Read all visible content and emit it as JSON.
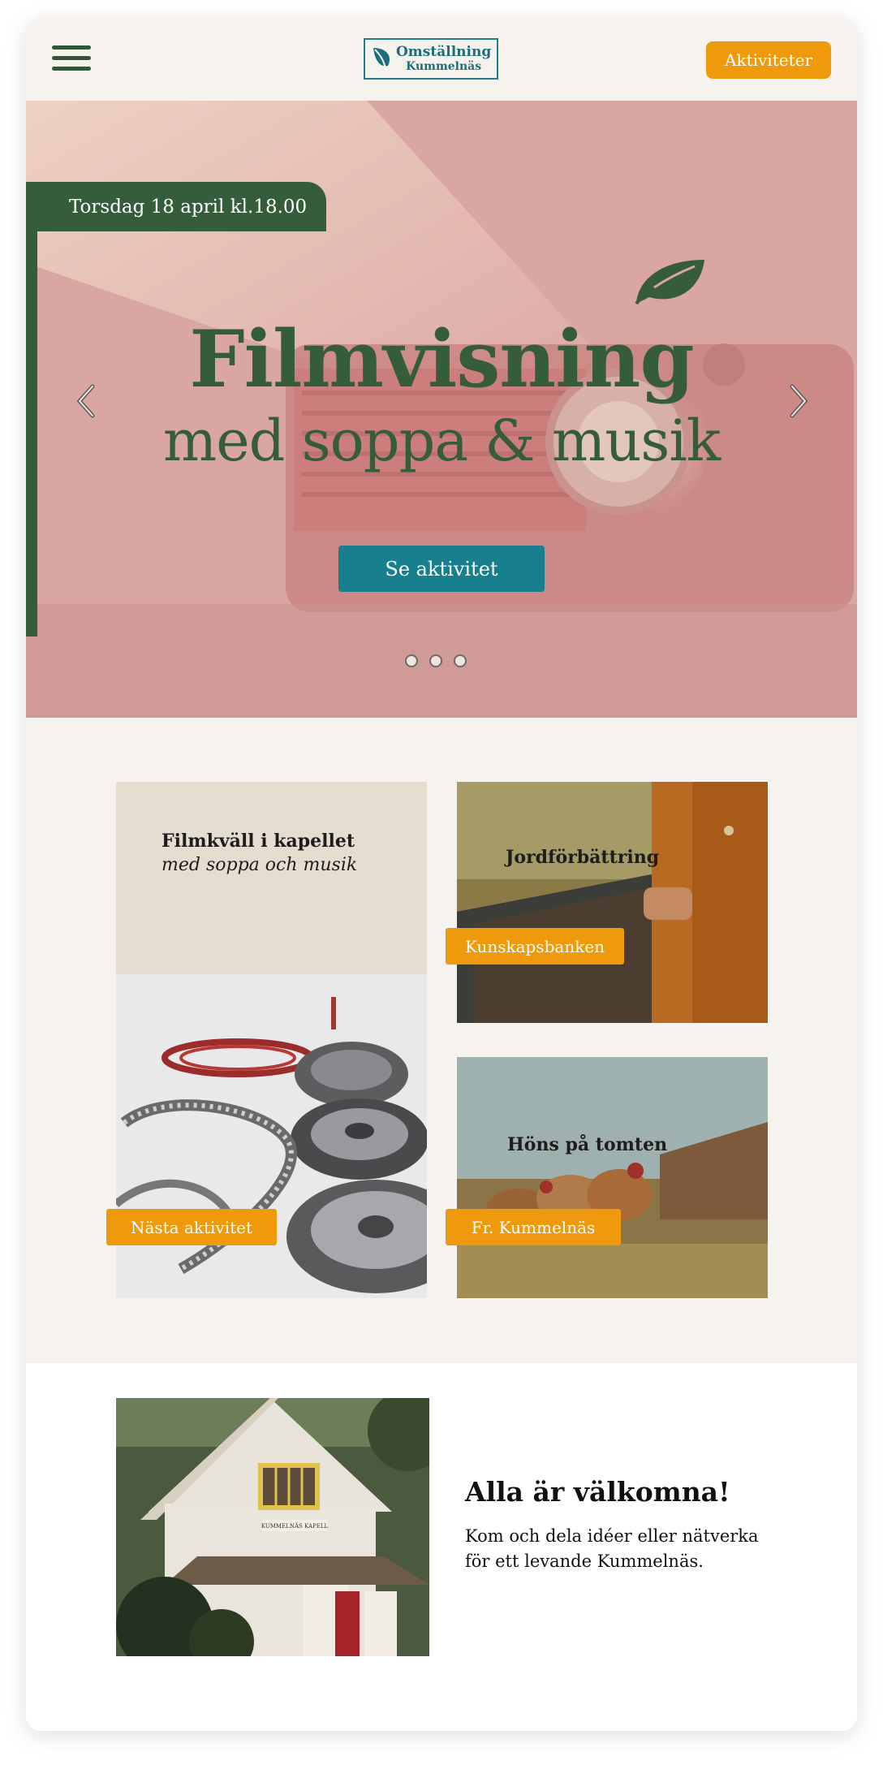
{
  "header": {
    "logo_line1": "Omställning",
    "logo_line2": "Kummelnäs",
    "menu_icon": "hamburger-menu-icon",
    "activities_button": "Aktiviteter"
  },
  "hero": {
    "date_tab": "Torsdag 18 april kl.18.00",
    "title": "Filmvisning",
    "subtitle": "med soppa & musik",
    "cta": "Se aktivitet",
    "prev_icon": "chevron-left-icon",
    "next_icon": "chevron-right-icon",
    "leaf_icon": "leaf-icon",
    "slide_count": 3
  },
  "cards": [
    {
      "title": "Filmkväll i kapellet",
      "subtitle": "med soppa och musik",
      "tag": "Nästa aktivitet"
    },
    {
      "title": "Jordförbättring",
      "tag": "Kunskapsbanken"
    },
    {
      "title": "Höns på tomten",
      "tag": "Fr. Kummelnäs"
    }
  ],
  "welcome": {
    "title": "Alla är välkomna!",
    "text": "Kom och dela idéer eller nätverka för ett levande Kummelnäs.",
    "chapel_sign": "KUMMELNÄS KAPELL"
  },
  "colors": {
    "brand_green": "#355d3b",
    "teal": "#177f8d",
    "orange": "#ef9a0c",
    "cream": "#f6f2ed"
  }
}
